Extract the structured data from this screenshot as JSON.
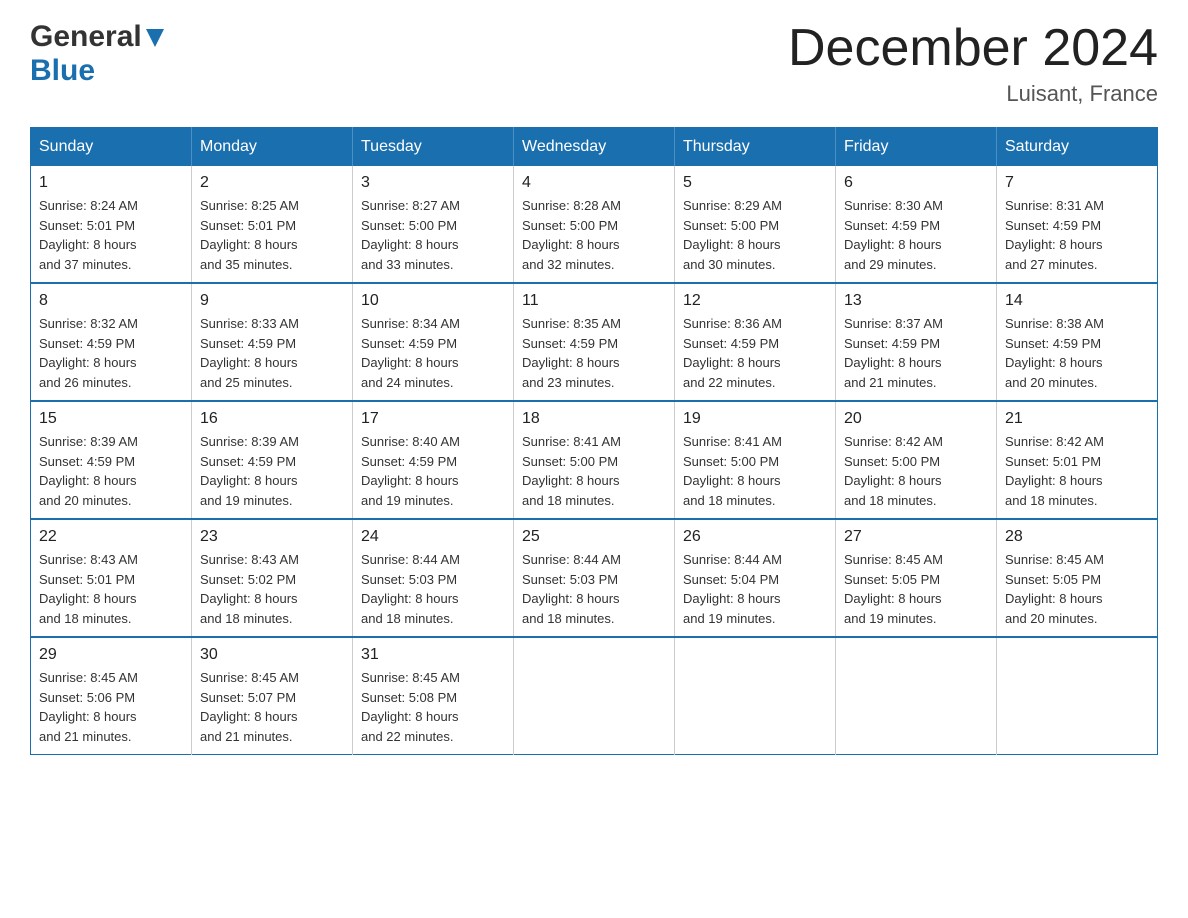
{
  "logo": {
    "general_text": "General",
    "blue_text": "Blue"
  },
  "title": {
    "month_year": "December 2024",
    "location": "Luisant, France"
  },
  "weekdays": [
    "Sunday",
    "Monday",
    "Tuesday",
    "Wednesday",
    "Thursday",
    "Friday",
    "Saturday"
  ],
  "weeks": [
    [
      {
        "day": 1,
        "sunrise": "8:24 AM",
        "sunset": "5:01 PM",
        "daylight": "8 hours and 37 minutes."
      },
      {
        "day": 2,
        "sunrise": "8:25 AM",
        "sunset": "5:01 PM",
        "daylight": "8 hours and 35 minutes."
      },
      {
        "day": 3,
        "sunrise": "8:27 AM",
        "sunset": "5:00 PM",
        "daylight": "8 hours and 33 minutes."
      },
      {
        "day": 4,
        "sunrise": "8:28 AM",
        "sunset": "5:00 PM",
        "daylight": "8 hours and 32 minutes."
      },
      {
        "day": 5,
        "sunrise": "8:29 AM",
        "sunset": "5:00 PM",
        "daylight": "8 hours and 30 minutes."
      },
      {
        "day": 6,
        "sunrise": "8:30 AM",
        "sunset": "4:59 PM",
        "daylight": "8 hours and 29 minutes."
      },
      {
        "day": 7,
        "sunrise": "8:31 AM",
        "sunset": "4:59 PM",
        "daylight": "8 hours and 27 minutes."
      }
    ],
    [
      {
        "day": 8,
        "sunrise": "8:32 AM",
        "sunset": "4:59 PM",
        "daylight": "8 hours and 26 minutes."
      },
      {
        "day": 9,
        "sunrise": "8:33 AM",
        "sunset": "4:59 PM",
        "daylight": "8 hours and 25 minutes."
      },
      {
        "day": 10,
        "sunrise": "8:34 AM",
        "sunset": "4:59 PM",
        "daylight": "8 hours and 24 minutes."
      },
      {
        "day": 11,
        "sunrise": "8:35 AM",
        "sunset": "4:59 PM",
        "daylight": "8 hours and 23 minutes."
      },
      {
        "day": 12,
        "sunrise": "8:36 AM",
        "sunset": "4:59 PM",
        "daylight": "8 hours and 22 minutes."
      },
      {
        "day": 13,
        "sunrise": "8:37 AM",
        "sunset": "4:59 PM",
        "daylight": "8 hours and 21 minutes."
      },
      {
        "day": 14,
        "sunrise": "8:38 AM",
        "sunset": "4:59 PM",
        "daylight": "8 hours and 20 minutes."
      }
    ],
    [
      {
        "day": 15,
        "sunrise": "8:39 AM",
        "sunset": "4:59 PM",
        "daylight": "8 hours and 20 minutes."
      },
      {
        "day": 16,
        "sunrise": "8:39 AM",
        "sunset": "4:59 PM",
        "daylight": "8 hours and 19 minutes."
      },
      {
        "day": 17,
        "sunrise": "8:40 AM",
        "sunset": "4:59 PM",
        "daylight": "8 hours and 19 minutes."
      },
      {
        "day": 18,
        "sunrise": "8:41 AM",
        "sunset": "5:00 PM",
        "daylight": "8 hours and 18 minutes."
      },
      {
        "day": 19,
        "sunrise": "8:41 AM",
        "sunset": "5:00 PM",
        "daylight": "8 hours and 18 minutes."
      },
      {
        "day": 20,
        "sunrise": "8:42 AM",
        "sunset": "5:00 PM",
        "daylight": "8 hours and 18 minutes."
      },
      {
        "day": 21,
        "sunrise": "8:42 AM",
        "sunset": "5:01 PM",
        "daylight": "8 hours and 18 minutes."
      }
    ],
    [
      {
        "day": 22,
        "sunrise": "8:43 AM",
        "sunset": "5:01 PM",
        "daylight": "8 hours and 18 minutes."
      },
      {
        "day": 23,
        "sunrise": "8:43 AM",
        "sunset": "5:02 PM",
        "daylight": "8 hours and 18 minutes."
      },
      {
        "day": 24,
        "sunrise": "8:44 AM",
        "sunset": "5:03 PM",
        "daylight": "8 hours and 18 minutes."
      },
      {
        "day": 25,
        "sunrise": "8:44 AM",
        "sunset": "5:03 PM",
        "daylight": "8 hours and 18 minutes."
      },
      {
        "day": 26,
        "sunrise": "8:44 AM",
        "sunset": "5:04 PM",
        "daylight": "8 hours and 19 minutes."
      },
      {
        "day": 27,
        "sunrise": "8:45 AM",
        "sunset": "5:05 PM",
        "daylight": "8 hours and 19 minutes."
      },
      {
        "day": 28,
        "sunrise": "8:45 AM",
        "sunset": "5:05 PM",
        "daylight": "8 hours and 20 minutes."
      }
    ],
    [
      {
        "day": 29,
        "sunrise": "8:45 AM",
        "sunset": "5:06 PM",
        "daylight": "8 hours and 21 minutes."
      },
      {
        "day": 30,
        "sunrise": "8:45 AM",
        "sunset": "5:07 PM",
        "daylight": "8 hours and 21 minutes."
      },
      {
        "day": 31,
        "sunrise": "8:45 AM",
        "sunset": "5:08 PM",
        "daylight": "8 hours and 22 minutes."
      },
      null,
      null,
      null,
      null
    ]
  ],
  "labels": {
    "sunrise": "Sunrise: ",
    "sunset": "Sunset: ",
    "daylight": "Daylight: "
  }
}
